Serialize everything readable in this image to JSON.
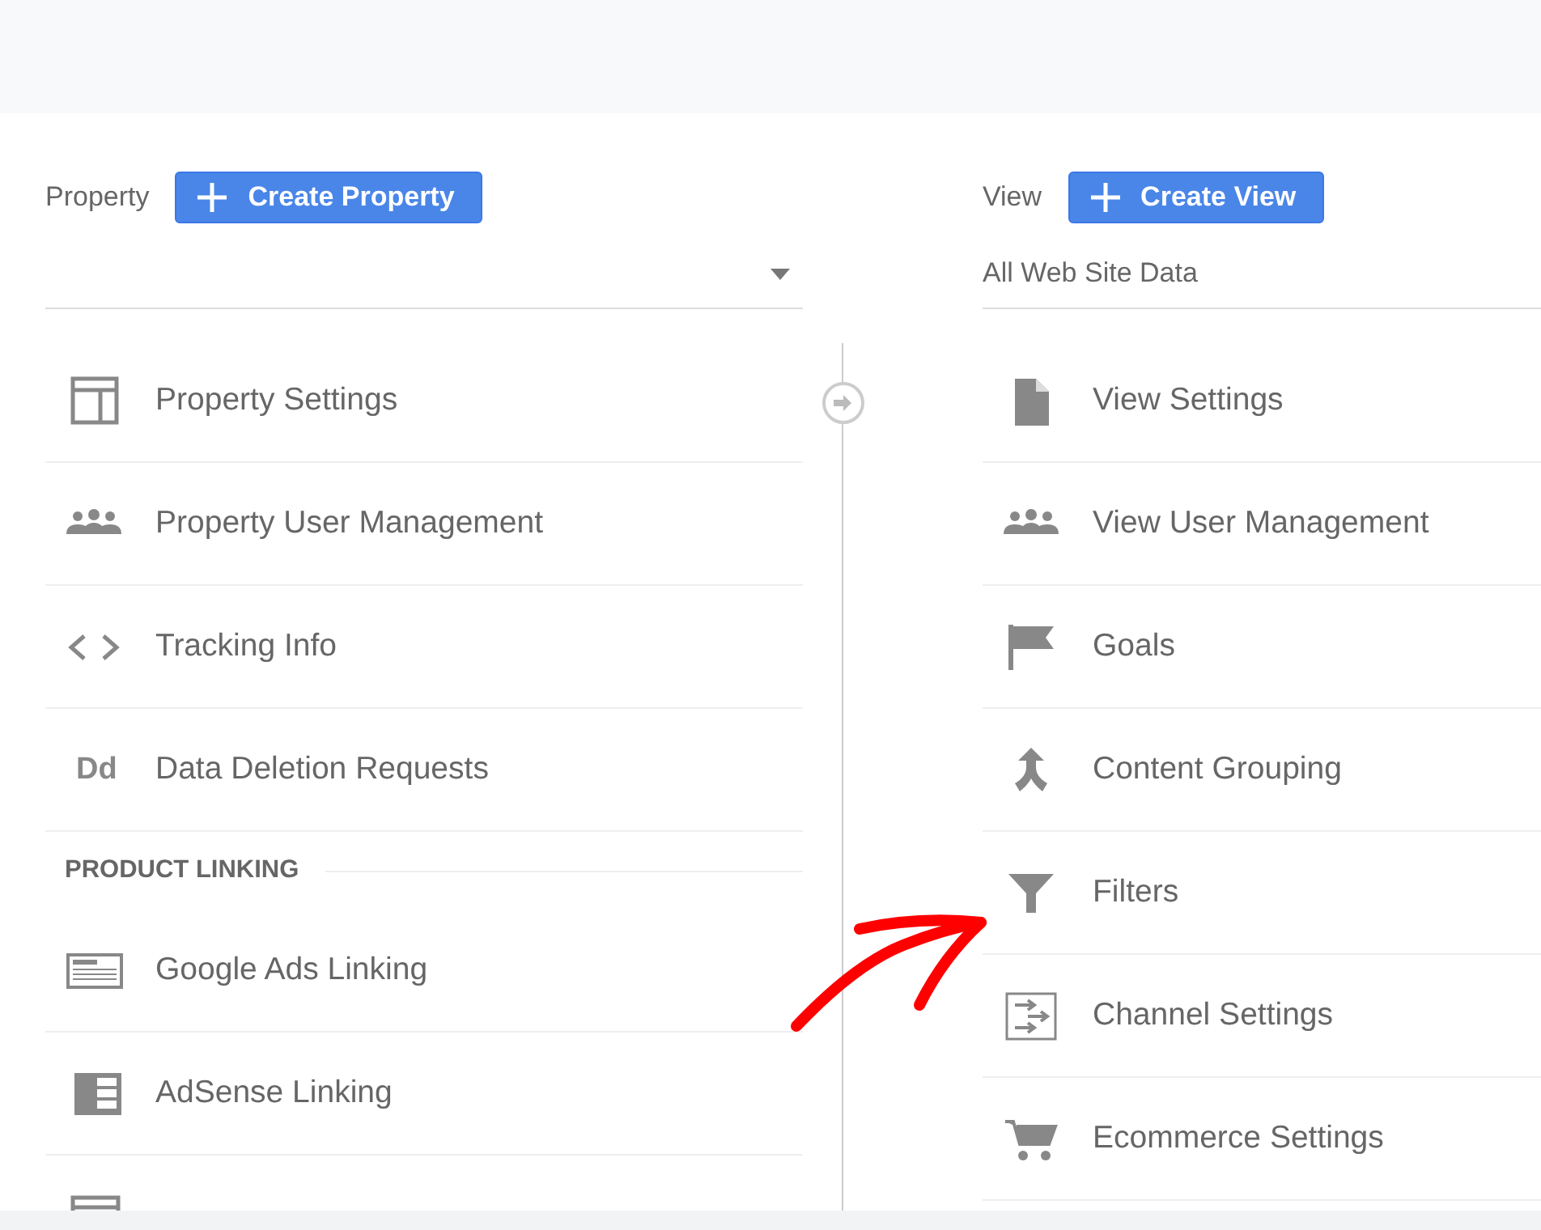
{
  "property_panel": {
    "label": "Property",
    "create_button": "Create Property",
    "items": [
      {
        "kind": "layout",
        "label": "Property Settings"
      },
      {
        "kind": "people",
        "label": "Property User Management"
      },
      {
        "kind": "code",
        "label": "Tracking Info"
      },
      {
        "kind": "text",
        "icon_text": "Dd",
        "label": "Data Deletion Requests"
      }
    ],
    "section": {
      "title": "PRODUCT LINKING",
      "items": [
        {
          "kind": "ads",
          "label": "Google Ads Linking"
        },
        {
          "kind": "adsense",
          "label": "AdSense Linking"
        },
        {
          "kind": "window"
        }
      ]
    }
  },
  "view_panel": {
    "label": "View",
    "create_button": "Create View",
    "dropdown": {
      "value": "All Web Site Data"
    },
    "items": [
      {
        "kind": "doc",
        "label": "View Settings"
      },
      {
        "kind": "people",
        "label": "View User Management"
      },
      {
        "kind": "flag",
        "label": "Goals"
      },
      {
        "kind": "merge",
        "label": "Content Grouping"
      },
      {
        "kind": "filter",
        "label": "Filters"
      },
      {
        "kind": "channels",
        "label": "Channel Settings"
      },
      {
        "kind": "cart",
        "label": "Ecommerce Settings"
      }
    ]
  }
}
